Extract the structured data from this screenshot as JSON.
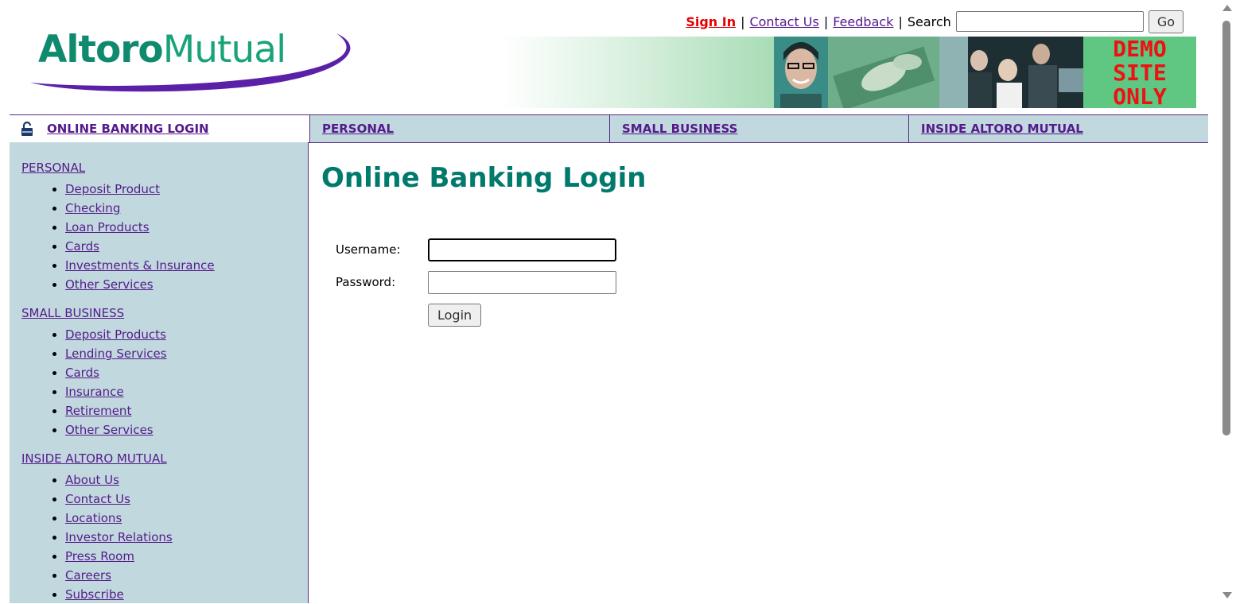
{
  "logo": {
    "part1": "Altoro",
    "part2": "Mutual"
  },
  "header": {
    "sign_in": "Sign In",
    "contact_us": "Contact Us",
    "feedback": "Feedback",
    "search_label": "Search",
    "search_value": "",
    "go": "Go",
    "separator": "|"
  },
  "banner": {
    "demo_lines": [
      "DEMO",
      "SITE",
      "ONLY"
    ]
  },
  "tabs": [
    {
      "label": "ONLINE BANKING LOGIN",
      "icon": "lock-icon"
    },
    {
      "label": "PERSONAL"
    },
    {
      "label": "SMALL BUSINESS"
    },
    {
      "label": "INSIDE ALTORO MUTUAL"
    }
  ],
  "sidebar": {
    "personal": {
      "title": "PERSONAL",
      "items": [
        "Deposit Product",
        "Checking",
        "Loan Products",
        "Cards",
        "Investments & Insurance",
        "Other Services"
      ]
    },
    "small_business": {
      "title": "SMALL BUSINESS",
      "items": [
        "Deposit Products",
        "Lending Services",
        "Cards",
        "Insurance",
        "Retirement",
        "Other Services"
      ]
    },
    "inside": {
      "title": "INSIDE ALTORO MUTUAL",
      "items": [
        "About Us",
        "Contact Us",
        "Locations",
        "Investor Relations",
        "Press Room",
        "Careers",
        "Subscribe"
      ]
    }
  },
  "main": {
    "title": "Online Banking Login",
    "username_label": "Username:",
    "username_value": "",
    "password_label": "Password:",
    "password_value": "",
    "login_button": "Login"
  },
  "colors": {
    "accent": "#007a6c",
    "nav_bg": "#c1d9de",
    "border": "#5b2a86",
    "link": "#551a8b",
    "sign_in": "#e60000"
  }
}
